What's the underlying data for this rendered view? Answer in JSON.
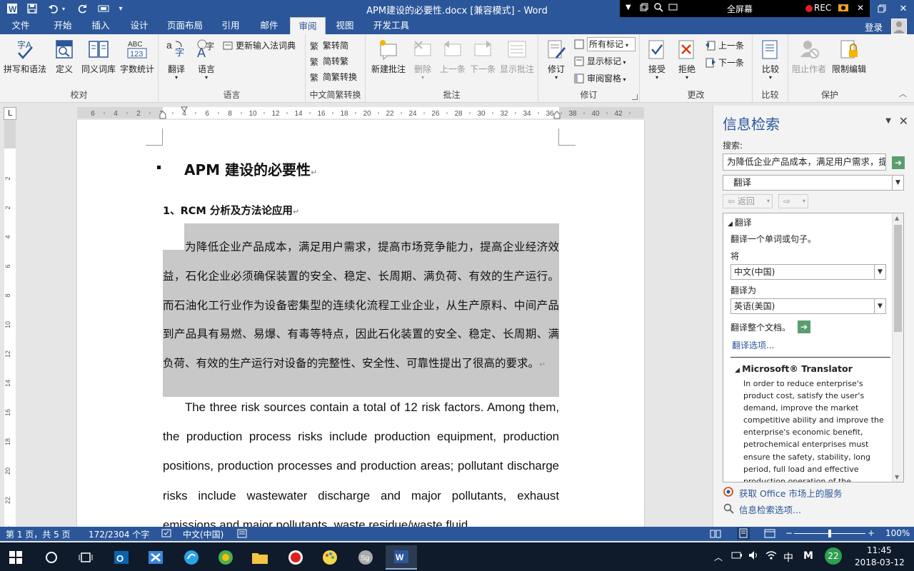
{
  "window": {
    "title": "APM建设的必要性.docx [兼容模式] - Word",
    "fullscreen_label": "全屏幕",
    "rec_label": "REC"
  },
  "tabs": [
    {
      "label": "文件",
      "active": false
    },
    {
      "label": "开始",
      "active": false
    },
    {
      "label": "插入",
      "active": false
    },
    {
      "label": "设计",
      "active": false
    },
    {
      "label": "页面布局",
      "active": false
    },
    {
      "label": "引用",
      "active": false
    },
    {
      "label": "邮件",
      "active": false
    },
    {
      "label": "审阅",
      "active": true
    },
    {
      "label": "视图",
      "active": false
    },
    {
      "label": "开发工具",
      "active": false
    }
  ],
  "login_label": "登录",
  "ribbon": {
    "groups": {
      "proofing": {
        "label": "校对",
        "buttons": [
          "拼写和语法",
          "定义",
          "同义词库",
          "字数统计"
        ]
      },
      "language": {
        "label": "语言",
        "buttons": [
          "翻译",
          "语言"
        ],
        "small": "更新输入法词典"
      },
      "chinese": {
        "label": "中文简繁转换",
        "items": [
          "繁转简",
          "简转繁",
          "简繁转换"
        ]
      },
      "comments": {
        "label": "批注",
        "buttons": [
          "新建批注",
          "删除",
          "上一条",
          "下一条",
          "显示批注"
        ]
      },
      "tracking": {
        "label": "修订",
        "button": "修订",
        "items": [
          "所有标记",
          "显示标记",
          "审阅窗格"
        ]
      },
      "changes": {
        "label": "更改",
        "buttons": [
          "接受",
          "拒绝"
        ],
        "items": [
          "上一条",
          "下一条"
        ]
      },
      "compare": {
        "label": "比较",
        "button": "比较"
      },
      "protect": {
        "label": "保护",
        "buttons": [
          "阻止作者",
          "限制编辑"
        ]
      }
    }
  },
  "ruler": {
    "corner": "L",
    "h_ticks": [
      "6",
      "4",
      "2",
      "2",
      "4",
      "6",
      "8",
      "10",
      "12",
      "14",
      "16",
      "18",
      "20",
      "22",
      "24",
      "26",
      "28",
      "30",
      "32",
      "34",
      "36",
      "38",
      "40",
      "42"
    ],
    "v_ticks": [
      "2",
      "2",
      "4",
      "6",
      "8",
      "10",
      "12",
      "14",
      "16",
      "18",
      "20",
      "22",
      "24"
    ]
  },
  "document": {
    "heading1": "APM 建设的必要性",
    "heading2": "1、RCM 分析及方法论应用",
    "para_cn": "为降低企业产品成本，满足用户需求，提高市场竞争能力，提高企业经济效益，石化企业必须确保装置的安全、稳定、长周期、满负荷、有效的生产运行。而石油化工行业作为设备密集型的连续化流程工业企业，从生产原料、中间产品到产品具有易燃、易爆、有毒等特点，因此石化装置的安全、稳定、长周期、满负荷、有效的生产运行对设备的完整性、安全性、可靠性提出了很高的要求。",
    "para_en": "The three risk sources contain a total of 12 risk factors. Among them, the production process risks include production equipment, production positions, production processes and production areas; pollutant discharge risks include wastewater discharge and major pollutants, exhaust emissions and major pollutants, waste residue/waste fluid",
    "para_mark": "↵"
  },
  "pane": {
    "title": "信息检索",
    "search_label": "搜索:",
    "search_value": "为降低企业产品成本，满足用户需求，提",
    "service": "翻译",
    "back_label": "返回",
    "section_title": "翻译",
    "hint": "翻译一个单词或句子。",
    "from_label": "将",
    "from_value": "中文(中国)",
    "to_label": "翻译为",
    "to_value": "英语(美国)",
    "whole_doc": "翻译整个文档。",
    "options_link": "翻译选项...",
    "ms_title": "Microsoft® Translator",
    "ms_text": "In order to reduce enterprise's product cost, satisfy the user's demand, improve the market competitive ability and improve the enterprise's economic benefit, petrochemical enterprises must ensure the safety, stability, long period, full load and effective production operation of the equipment. and petrochemical industry as a device intensive continuous process",
    "link1": "获取 Office 市场上的服务",
    "link2": "信息检索选项..."
  },
  "status": {
    "page": "第 1 页，共 5 页",
    "words": "172/2304 个字",
    "language": "中文(中国)",
    "zoom": "100%",
    "zoom_fraction": 0.5
  },
  "taskbar": {
    "time": "11:45",
    "date": "2018-03-12",
    "ime": "中",
    "ime2": "M",
    "badge": "22"
  },
  "colors": {
    "accent": "#2b579a",
    "selection": "#c8c8c8"
  }
}
